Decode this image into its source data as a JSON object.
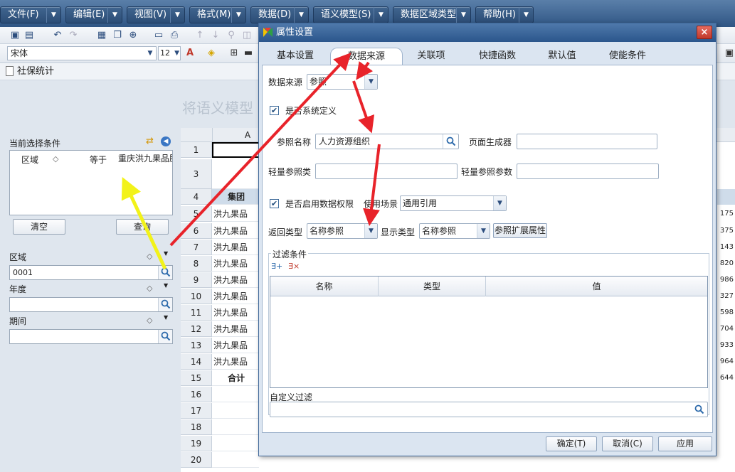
{
  "menu": {
    "items": [
      {
        "label": "文件(F)"
      },
      {
        "label": "编辑(E)"
      },
      {
        "label": "视图(V)"
      },
      {
        "label": "格式(M)"
      },
      {
        "label": "数据(D)"
      },
      {
        "label": "语义模型(S)"
      },
      {
        "label": "数据区域类型"
      },
      {
        "label": "帮助(H)"
      }
    ]
  },
  "toolbar": {
    "font_name": "宋体",
    "font_size": "12"
  },
  "breadcrumb": {
    "title": "社保统计"
  },
  "left_panel": {
    "faded_title": "将语义模型",
    "conditions_title": "当前选择条件",
    "condition_row": {
      "field": "区域",
      "op": "等于",
      "value": "重庆洪九果品股"
    },
    "clear_label": "清空",
    "query_label": "查询",
    "filters": [
      {
        "label": "区域",
        "value": "0001"
      },
      {
        "label": "年度",
        "value": ""
      },
      {
        "label": "期间",
        "value": ""
      }
    ]
  },
  "sheet": {
    "col_a": "A",
    "rows": [
      {
        "n": "1",
        "a": "",
        "r": ""
      },
      {
        "n": "3",
        "a": "",
        "r": ""
      },
      {
        "n": "4",
        "a": "集团",
        "r": ""
      },
      {
        "n": "5",
        "a": "洪九果品",
        "r": "175"
      },
      {
        "n": "6",
        "a": "洪九果品",
        "r": "375"
      },
      {
        "n": "7",
        "a": "洪九果品",
        "r": "143"
      },
      {
        "n": "8",
        "a": "洪九果品",
        "r": "820"
      },
      {
        "n": "9",
        "a": "洪九果品",
        "r": "986"
      },
      {
        "n": "10",
        "a": "洪九果品",
        "r": "327"
      },
      {
        "n": "11",
        "a": "洪九果品",
        "r": "598"
      },
      {
        "n": "12",
        "a": "洪九果品",
        "r": "704"
      },
      {
        "n": "13",
        "a": "洪九果品",
        "r": "933"
      },
      {
        "n": "14",
        "a": "洪九果品",
        "r": "964"
      },
      {
        "n": "15",
        "a": "合计",
        "r": "644"
      },
      {
        "n": "16",
        "a": "",
        "r": ""
      },
      {
        "n": "17",
        "a": "",
        "r": ""
      },
      {
        "n": "18",
        "a": "",
        "r": ""
      },
      {
        "n": "19",
        "a": "",
        "r": ""
      },
      {
        "n": "20",
        "a": "",
        "r": ""
      }
    ]
  },
  "dialog": {
    "title": "属性设置",
    "tabs": [
      {
        "label": "基本设置"
      },
      {
        "label": "数据来源"
      },
      {
        "label": "关联项"
      },
      {
        "label": "快捷函数"
      },
      {
        "label": "默认值"
      },
      {
        "label": "使能条件"
      }
    ],
    "data_source_label": "数据来源",
    "data_source_value": "参照",
    "system_defined_label": "是否系统定义",
    "ref_name_label": "参照名称",
    "ref_name_value": "人力资源组织",
    "page_generator_label": "页面生成器",
    "light_ref_class_label": "轻量参照类",
    "light_ref_param_label": "轻量参照参数",
    "data_permission_label": "是否启用数据权限",
    "usage_scene_label": "使用场景",
    "usage_scene_value": "通用引用",
    "return_type_label": "返回类型",
    "return_type_value": "名称参照",
    "display_type_label": "显示类型",
    "display_type_value": "名称参照",
    "ref_ext_button": "参照扩展属性",
    "filter_group_label": "过滤条件",
    "filter_columns": [
      "名称",
      "类型",
      "值"
    ],
    "custom_filter_label": "自定义过滤",
    "ok_label": "确定(T)",
    "cancel_label": "取消(C)",
    "apply_label": "应用"
  },
  "colors": {
    "menu_bg": "#2f5584",
    "dialog_title": "#2b568c",
    "annotation_red": "#e8232a",
    "annotation_yellow": "#f2f21a"
  }
}
